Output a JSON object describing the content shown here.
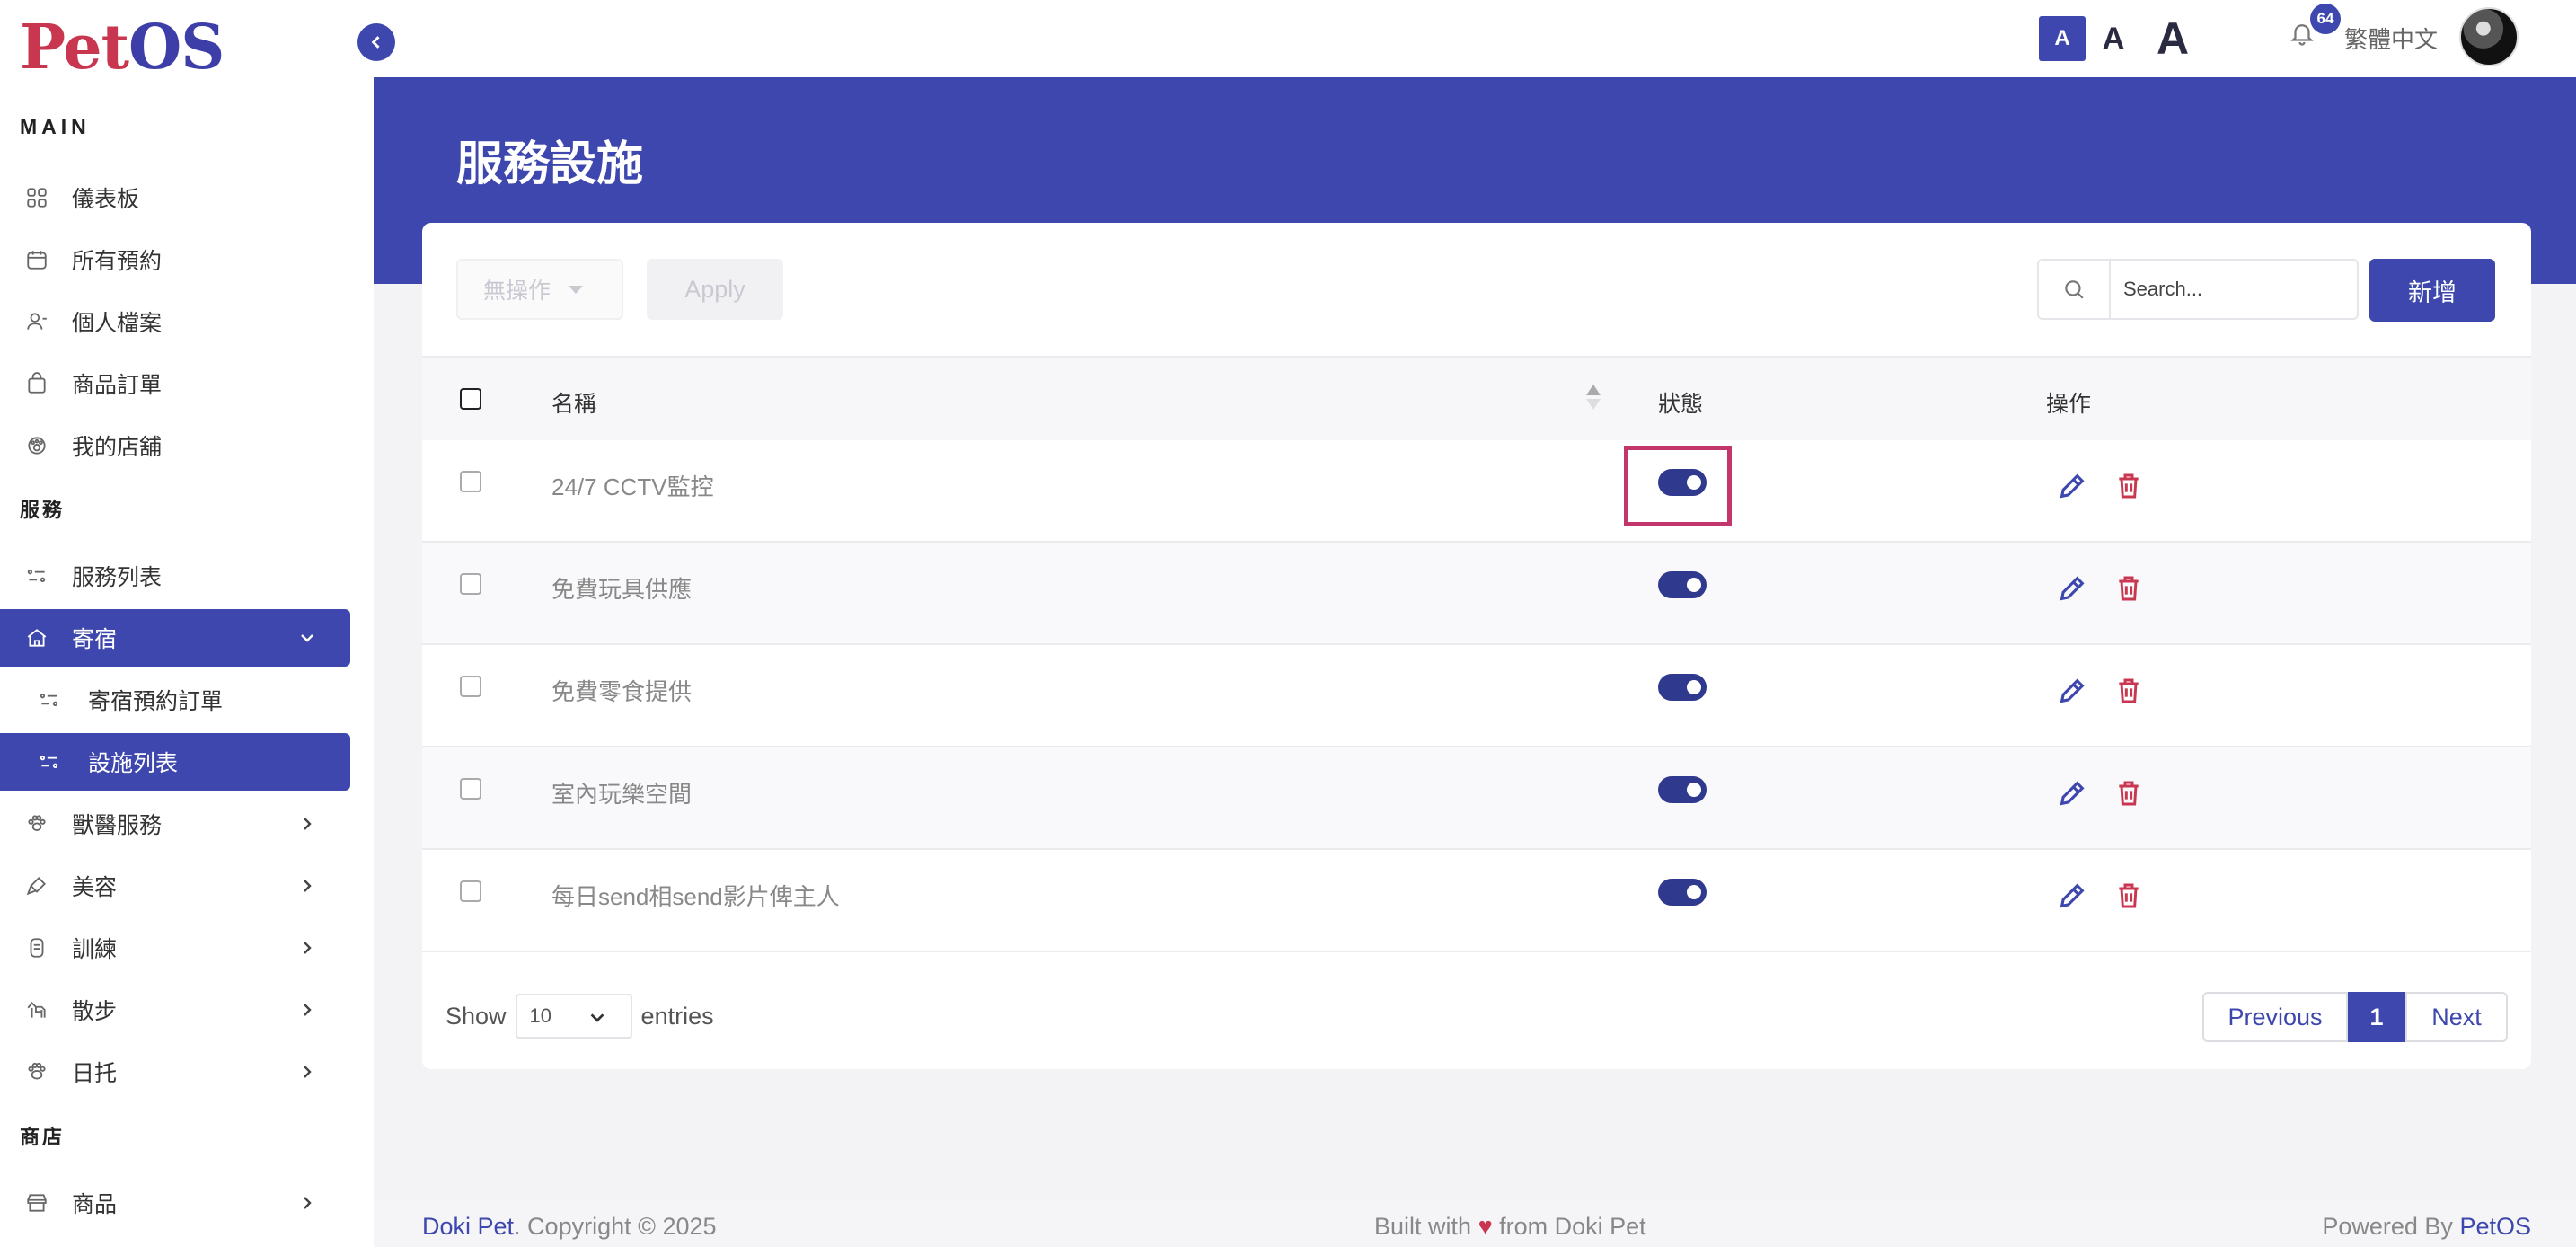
{
  "app": {
    "logo_part1": "Pet",
    "logo_part2": "OS"
  },
  "sidebar": {
    "main_title": "MAIN",
    "main_items": [
      {
        "label": "儀表板",
        "icon": "grid-icon"
      },
      {
        "label": "所有預約",
        "icon": "calendar-icon"
      },
      {
        "label": "個人檔案",
        "icon": "user-icon"
      },
      {
        "label": "商品訂單",
        "icon": "shopping-bag-icon"
      },
      {
        "label": "我的店舖",
        "icon": "paw-icon"
      }
    ],
    "services_title": "服務",
    "service_items": [
      {
        "label": "服務列表",
        "icon": "list-icon"
      },
      {
        "label": "寄宿",
        "icon": "home-icon",
        "active": true,
        "expanded": true
      },
      {
        "label": "寄宿預約訂單",
        "icon": "list-icon",
        "sub": true
      },
      {
        "label": "設施列表",
        "icon": "list-icon",
        "sub": true,
        "active": true
      },
      {
        "label": "獸醫服務",
        "icon": "paw-icon"
      },
      {
        "label": "美容",
        "icon": "brush-icon"
      },
      {
        "label": "訓練",
        "icon": "medal-icon"
      },
      {
        "label": "散步",
        "icon": "dog-icon"
      },
      {
        "label": "日托",
        "icon": "paw-icon"
      }
    ],
    "shop_title": "商店",
    "shop_items": [
      {
        "label": "商品",
        "icon": "store-icon"
      }
    ]
  },
  "topbar": {
    "font_small": "A",
    "font_medium": "A",
    "font_large": "A",
    "notification_count": "64",
    "language": "繁體中文"
  },
  "page": {
    "title": "服務設施"
  },
  "toolbar": {
    "bulk_action": "無操作",
    "apply_label": "Apply",
    "search_placeholder": "Search...",
    "add_label": "新增"
  },
  "table": {
    "columns": [
      "名稱",
      "狀態",
      "操作"
    ],
    "rows": [
      {
        "name": "24/7 CCTV監控",
        "enabled": true
      },
      {
        "name": "免費玩具供應",
        "enabled": true
      },
      {
        "name": "免費零食提供",
        "enabled": true
      },
      {
        "name": "室內玩樂空間",
        "enabled": true
      },
      {
        "name": "每日send相send影片俾主人",
        "enabled": true
      }
    ]
  },
  "pagination": {
    "show_label": "Show",
    "page_length": "10",
    "entries_label": "entries",
    "previous_label": "Previous",
    "current_page": "1",
    "next_label": "Next"
  },
  "footer": {
    "brand": "Doki Pet",
    "copyright": ". Copyright © 2025",
    "built_prefix": "Built with",
    "heart": "♥",
    "built_suffix": "from Doki Pet",
    "powered_prefix": "Powered By",
    "powered_brand": "PetOS"
  },
  "colors": {
    "primary": "#3e47ad",
    "accent": "#c8374f",
    "highlight_box": "#c1366b"
  }
}
